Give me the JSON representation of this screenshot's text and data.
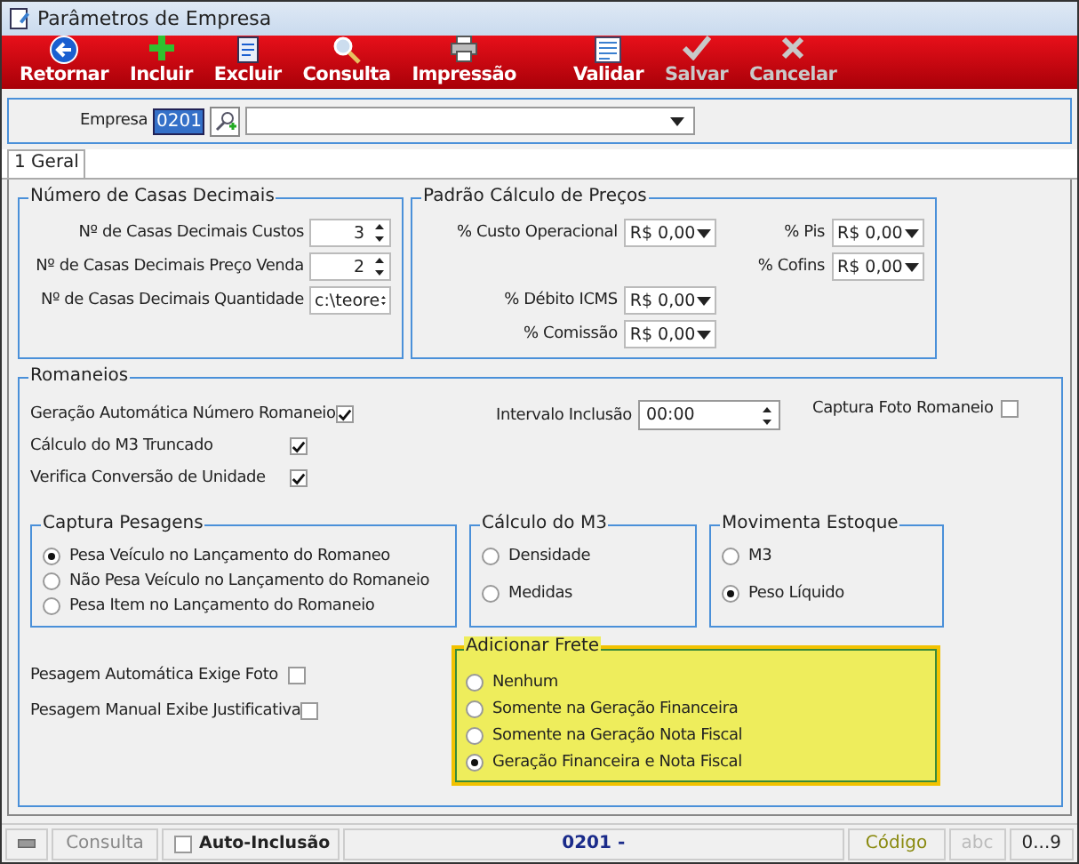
{
  "window": {
    "title": "Parâmetros de Empresa"
  },
  "toolbar": [
    {
      "label": "Retornar",
      "kind": "back",
      "disabled": false
    },
    {
      "label": "Incluir",
      "kind": "add",
      "disabled": false
    },
    {
      "label": "Excluir",
      "kind": "delete",
      "disabled": false
    },
    {
      "label": "Consulta",
      "kind": "search",
      "disabled": false
    },
    {
      "label": "Impressão",
      "kind": "print",
      "disabled": false
    },
    {
      "label": "Validar",
      "kind": "validate",
      "disabled": false
    },
    {
      "label": "Salvar",
      "kind": "save",
      "disabled": true
    },
    {
      "label": "Cancelar",
      "kind": "cancel",
      "disabled": true
    }
  ],
  "empresa": {
    "label": "Empresa",
    "value": "0201"
  },
  "tabs": [
    {
      "label": "1 Geral",
      "selected": true
    }
  ],
  "casas_decimais": {
    "title": "Número de Casas Decimais",
    "fields": [
      {
        "label": "Nº de Casas Decimais Custos",
        "value": "3"
      },
      {
        "label": "Nº de Casas Decimais Preço Venda",
        "value": "2"
      },
      {
        "label": "Nº de Casas Decimais Quantidade",
        "value": "c:\\teore"
      }
    ]
  },
  "padrao_precos": {
    "title": "Padrão Cálculo de Preços",
    "fields": [
      {
        "label": "% Custo Operacional",
        "value": "R$ 0,00"
      },
      {
        "label": "% Pis",
        "value": "R$ 0,00"
      },
      {
        "label": "% Cofins",
        "value": "R$ 0,00"
      },
      {
        "label": "% Débito ICMS",
        "value": "R$ 0,00"
      },
      {
        "label": "% Comissão",
        "value": "R$ 0,00"
      }
    ]
  },
  "romaneios": {
    "title": "Romaneios",
    "checks": [
      {
        "label": "Geração Automática Número Romaneio",
        "checked": true
      },
      {
        "label": "Cálculo do M3 Truncado",
        "checked": true
      },
      {
        "label": "Verifica Conversão de Unidade",
        "checked": true
      }
    ],
    "intervalo": {
      "label": "Intervalo Inclusão",
      "value": "00:00"
    },
    "captura_foto": {
      "label": "Captura Foto Romaneio",
      "checked": false
    },
    "groups": [
      {
        "title": "Captura Pesagens",
        "options": [
          {
            "label": "Pesa Veículo no Lançamento do Romaneo",
            "selected": true
          },
          {
            "label": "Não Pesa Veículo no Lançamento do Romaneio",
            "selected": false
          },
          {
            "label": "Pesa Item no Lançamento do Romaneio",
            "selected": false
          }
        ]
      },
      {
        "title": "Cálculo do M3",
        "options": [
          {
            "label": "Densidade",
            "selected": false
          },
          {
            "label": "Medidas",
            "selected": false
          }
        ]
      },
      {
        "title": "Movimenta Estoque",
        "options": [
          {
            "label": "M3",
            "selected": false
          },
          {
            "label": "Peso Líquido",
            "selected": true
          }
        ]
      }
    ],
    "pesagem_checks": [
      {
        "label": "Pesagem Automática Exige Foto",
        "checked": false
      },
      {
        "label": "Pesagem Manual Exibe Justificativa",
        "checked": false
      }
    ],
    "adicionar_frete": {
      "title": "Adicionar Frete",
      "highlighted": true,
      "options": [
        {
          "label": "Nenhum",
          "selected": false
        },
        {
          "label": "Somente na Geração Financeira",
          "selected": false
        },
        {
          "label": "Somente na Geração Nota Fiscal",
          "selected": false
        },
        {
          "label": "Geração Financeira e Nota Fiscal",
          "selected": true
        }
      ]
    }
  },
  "status_bar": {
    "mode": "Consulta",
    "auto_inclusao": {
      "label": "Auto-Inclusão",
      "checked": false
    },
    "record": "0201 -",
    "key": "Código",
    "abc": "abc",
    "digits": "0...9"
  }
}
